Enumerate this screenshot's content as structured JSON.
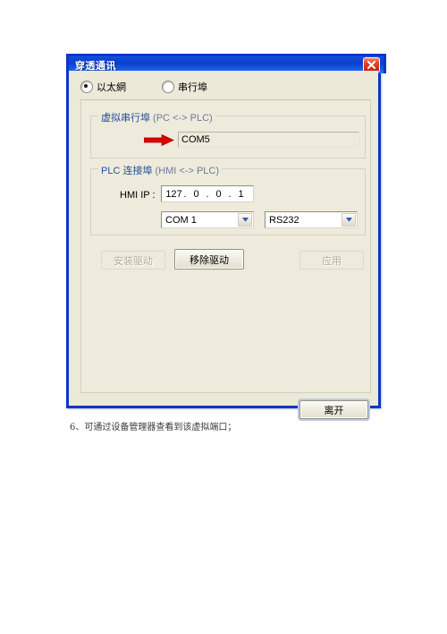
{
  "window": {
    "title": "穿透通讯",
    "close_icon": "close-x-icon"
  },
  "connection_mode": {
    "options": [
      {
        "label": "以太網",
        "selected": true
      },
      {
        "label": "串行埠",
        "selected": false
      }
    ]
  },
  "virtual_port_group": {
    "title_main": "虚拟串行埠",
    "title_suffix": " (PC <-> PLC)",
    "arrow_icon": "red-right-arrow-icon",
    "port_value": "COM5"
  },
  "plc_group": {
    "title_main": "PLC 连接埠",
    "title_suffix": " (HMI <-> PLC)",
    "hmi_ip_label": "HMI IP :",
    "ip": {
      "octet1": "127",
      "octet2": "0",
      "octet3": "0",
      "octet4": "1",
      "separator": "."
    },
    "com_select": {
      "value": "COM 1",
      "chevron_icon": "chevron-down-icon"
    },
    "mode_select": {
      "value": "RS232",
      "chevron_icon": "chevron-down-icon"
    }
  },
  "actions": {
    "install_driver": "安装驱动",
    "remove_driver": "移除驱动",
    "apply": "应用",
    "leave": "离开"
  },
  "page": {
    "caption": "6、可通过设备管理器查看到该虚拟端口；"
  },
  "colors": {
    "titlebar_blue": "#0a3fd0",
    "dialog_border": "#0a36c8",
    "face": "#ece9d8",
    "panel": "#eeebdc",
    "group_title": "#21509c",
    "arrow_red": "#e00000",
    "close_red": "#c71c0b"
  }
}
